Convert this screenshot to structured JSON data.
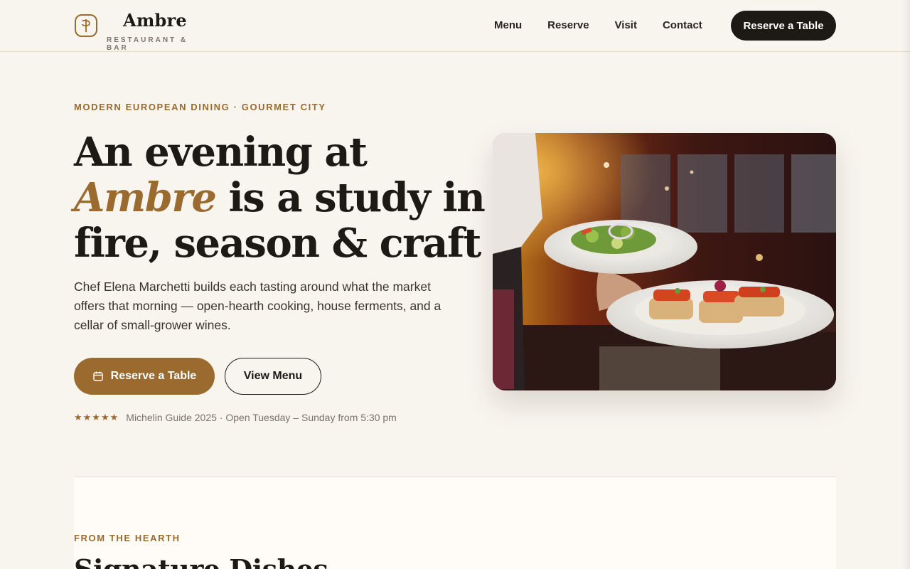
{
  "brand": {
    "name": "Ambre",
    "tagline": "RESTAURANT & BAR",
    "accent_color": "#9a6a2f",
    "dark_color": "#1d1915",
    "logo_icon": "monogram-logo-icon"
  },
  "nav": {
    "items": [
      {
        "label": "Menu"
      },
      {
        "label": "Reserve"
      },
      {
        "label": "Visit"
      },
      {
        "label": "Contact"
      }
    ],
    "cta_label": "Reserve a Table"
  },
  "hero": {
    "eyebrow": "MODERN EUROPEAN DINING · GOURMET CITY",
    "headline_part1": "An evening at ",
    "headline_accent": "Ambre",
    "headline_part2": " is a study in fire, season & craft",
    "lead": "Chef Elena Marchetti builds each tasting around what the market offers that morning — open-hearth cooking, house ferments, and a cellar of small-grower wines.",
    "primary_button": "Reserve a Table",
    "primary_button_icon": "calendar-icon",
    "secondary_button": "View Menu",
    "stars": "★★★★★",
    "rating_text": "Michelin Guide 2025 · Open Tuesday – Sunday from 5:30 pm",
    "image_subject": "waiter-holding-plates-photo"
  },
  "section": {
    "eyebrow": "FROM THE HEARTH",
    "title": "Signature Dishes"
  }
}
